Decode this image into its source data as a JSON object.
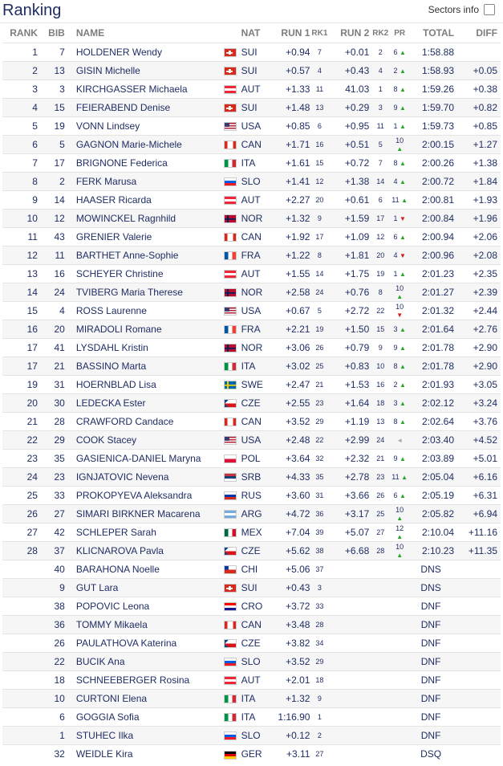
{
  "page": {
    "title": "Ranking",
    "sectors_label": "Sectors info"
  },
  "columns": {
    "rank": "RANK",
    "bib": "BIB",
    "name": "NAME",
    "nat": "NAT",
    "run1": "RUN 1",
    "rk1": "RK1",
    "run2": "RUN 2",
    "rk2": "RK2",
    "pr": "PR",
    "total": "TOTAL",
    "diff": "DIFF"
  },
  "rows": [
    {
      "rank": "1",
      "bib": "7",
      "name": "HOLDENER Wendy",
      "nat": "SUI",
      "run1": "+0.94",
      "rk1": "7",
      "run2": "+0.01",
      "rk2": "2",
      "pr": "6",
      "dir": "up",
      "total": "1:58.88",
      "diff": ""
    },
    {
      "rank": "2",
      "bib": "13",
      "name": "GISIN Michelle",
      "nat": "SUI",
      "run1": "+0.57",
      "rk1": "4",
      "run2": "+0.43",
      "rk2": "4",
      "pr": "2",
      "dir": "up",
      "total": "1:58.93",
      "diff": "+0.05"
    },
    {
      "rank": "3",
      "bib": "3",
      "name": "KIRCHGASSER Michaela",
      "nat": "AUT",
      "run1": "+1.33",
      "rk1": "11",
      "run2": "41.03",
      "rk2": "1",
      "pr": "8",
      "dir": "up",
      "total": "1:59.26",
      "diff": "+0.38"
    },
    {
      "rank": "4",
      "bib": "15",
      "name": "FEIERABEND Denise",
      "nat": "SUI",
      "run1": "+1.48",
      "rk1": "13",
      "run2": "+0.29",
      "rk2": "3",
      "pr": "9",
      "dir": "up",
      "total": "1:59.70",
      "diff": "+0.82"
    },
    {
      "rank": "5",
      "bib": "19",
      "name": "VONN Lindsey",
      "nat": "USA",
      "run1": "+0.85",
      "rk1": "6",
      "run2": "+0.95",
      "rk2": "11",
      "pr": "1",
      "dir": "up",
      "total": "1:59.73",
      "diff": "+0.85"
    },
    {
      "rank": "6",
      "bib": "5",
      "name": "GAGNON Marie-Michele",
      "nat": "CAN",
      "run1": "+1.71",
      "rk1": "16",
      "run2": "+0.51",
      "rk2": "5",
      "pr": "10",
      "dir": "up",
      "total": "2:00.15",
      "diff": "+1.27"
    },
    {
      "rank": "7",
      "bib": "17",
      "name": "BRIGNONE Federica",
      "nat": "ITA",
      "run1": "+1.61",
      "rk1": "15",
      "run2": "+0.72",
      "rk2": "7",
      "pr": "8",
      "dir": "up",
      "total": "2:00.26",
      "diff": "+1.38"
    },
    {
      "rank": "8",
      "bib": "2",
      "name": "FERK Marusa",
      "nat": "SLO",
      "run1": "+1.41",
      "rk1": "12",
      "run2": "+1.38",
      "rk2": "14",
      "pr": "4",
      "dir": "up",
      "total": "2:00.72",
      "diff": "+1.84"
    },
    {
      "rank": "9",
      "bib": "14",
      "name": "HAASER Ricarda",
      "nat": "AUT",
      "run1": "+2.27",
      "rk1": "20",
      "run2": "+0.61",
      "rk2": "6",
      "pr": "11",
      "dir": "up",
      "total": "2:00.81",
      "diff": "+1.93"
    },
    {
      "rank": "10",
      "bib": "12",
      "name": "MOWINCKEL Ragnhild",
      "nat": "NOR",
      "run1": "+1.32",
      "rk1": "9",
      "run2": "+1.59",
      "rk2": "17",
      "pr": "1",
      "dir": "down",
      "total": "2:00.84",
      "diff": "+1.96"
    },
    {
      "rank": "11",
      "bib": "43",
      "name": "GRENIER Valerie",
      "nat": "CAN",
      "run1": "+1.92",
      "rk1": "17",
      "run2": "+1.09",
      "rk2": "12",
      "pr": "6",
      "dir": "up",
      "total": "2:00.94",
      "diff": "+2.06"
    },
    {
      "rank": "12",
      "bib": "11",
      "name": "BARTHET Anne-Sophie",
      "nat": "FRA",
      "run1": "+1.22",
      "rk1": "8",
      "run2": "+1.81",
      "rk2": "20",
      "pr": "4",
      "dir": "down",
      "total": "2:00.96",
      "diff": "+2.08"
    },
    {
      "rank": "13",
      "bib": "16",
      "name": "SCHEYER Christine",
      "nat": "AUT",
      "run1": "+1.55",
      "rk1": "14",
      "run2": "+1.75",
      "rk2": "19",
      "pr": "1",
      "dir": "up",
      "total": "2:01.23",
      "diff": "+2.35"
    },
    {
      "rank": "14",
      "bib": "24",
      "name": "TVIBERG Maria Therese",
      "nat": "NOR",
      "run1": "+2.58",
      "rk1": "24",
      "run2": "+0.76",
      "rk2": "8",
      "pr": "10",
      "dir": "up",
      "total": "2:01.27",
      "diff": "+2.39"
    },
    {
      "rank": "15",
      "bib": "4",
      "name": "ROSS Laurenne",
      "nat": "USA",
      "run1": "+0.67",
      "rk1": "5",
      "run2": "+2.72",
      "rk2": "22",
      "pr": "10",
      "dir": "down",
      "total": "2:01.32",
      "diff": "+2.44"
    },
    {
      "rank": "16",
      "bib": "20",
      "name": "MIRADOLI Romane",
      "nat": "FRA",
      "run1": "+2.21",
      "rk1": "19",
      "run2": "+1.50",
      "rk2": "15",
      "pr": "3",
      "dir": "up",
      "total": "2:01.64",
      "diff": "+2.76"
    },
    {
      "rank": "17",
      "bib": "41",
      "name": "LYSDAHL Kristin",
      "nat": "NOR",
      "run1": "+3.06",
      "rk1": "26",
      "run2": "+0.79",
      "rk2": "9",
      "pr": "9",
      "dir": "up",
      "total": "2:01.78",
      "diff": "+2.90"
    },
    {
      "rank": "17",
      "bib": "21",
      "name": "BASSINO Marta",
      "nat": "ITA",
      "run1": "+3.02",
      "rk1": "25",
      "run2": "+0.83",
      "rk2": "10",
      "pr": "8",
      "dir": "up",
      "total": "2:01.78",
      "diff": "+2.90"
    },
    {
      "rank": "19",
      "bib": "31",
      "name": "HOERNBLAD Lisa",
      "nat": "SWE",
      "run1": "+2.47",
      "rk1": "21",
      "run2": "+1.53",
      "rk2": "16",
      "pr": "2",
      "dir": "up",
      "total": "2:01.93",
      "diff": "+3.05"
    },
    {
      "rank": "20",
      "bib": "30",
      "name": "LEDECKA Ester",
      "nat": "CZE",
      "run1": "+2.55",
      "rk1": "23",
      "run2": "+1.64",
      "rk2": "18",
      "pr": "3",
      "dir": "up",
      "total": "2:02.12",
      "diff": "+3.24"
    },
    {
      "rank": "21",
      "bib": "28",
      "name": "CRAWFORD Candace",
      "nat": "CAN",
      "run1": "+3.52",
      "rk1": "29",
      "run2": "+1.19",
      "rk2": "13",
      "pr": "8",
      "dir": "up",
      "total": "2:02.64",
      "diff": "+3.76"
    },
    {
      "rank": "22",
      "bib": "29",
      "name": "COOK Stacey",
      "nat": "USA",
      "run1": "+2.48",
      "rk1": "22",
      "run2": "+2.99",
      "rk2": "24",
      "pr": "",
      "dir": "eq",
      "total": "2:03.40",
      "diff": "+4.52"
    },
    {
      "rank": "23",
      "bib": "35",
      "name": "GASIENICA-DANIEL Maryna",
      "nat": "POL",
      "run1": "+3.64",
      "rk1": "32",
      "run2": "+2.32",
      "rk2": "21",
      "pr": "9",
      "dir": "up",
      "total": "2:03.89",
      "diff": "+5.01"
    },
    {
      "rank": "24",
      "bib": "23",
      "name": "IGNJATOVIC Nevena",
      "nat": "SRB",
      "run1": "+4.33",
      "rk1": "35",
      "run2": "+2.78",
      "rk2": "23",
      "pr": "11",
      "dir": "up",
      "total": "2:05.04",
      "diff": "+6.16"
    },
    {
      "rank": "25",
      "bib": "33",
      "name": "PROKOPYEVA Aleksandra",
      "nat": "RUS",
      "run1": "+3.60",
      "rk1": "31",
      "run2": "+3.66",
      "rk2": "26",
      "pr": "6",
      "dir": "up",
      "total": "2:05.19",
      "diff": "+6.31"
    },
    {
      "rank": "26",
      "bib": "27",
      "name": "SIMARI BIRKNER Macarena",
      "nat": "ARG",
      "run1": "+4.72",
      "rk1": "36",
      "run2": "+3.17",
      "rk2": "25",
      "pr": "10",
      "dir": "up",
      "total": "2:05.82",
      "diff": "+6.94"
    },
    {
      "rank": "27",
      "bib": "42",
      "name": "SCHLEPER Sarah",
      "nat": "MEX",
      "run1": "+7.04",
      "rk1": "39",
      "run2": "+5.07",
      "rk2": "27",
      "pr": "12",
      "dir": "up",
      "total": "2:10.04",
      "diff": "+11.16"
    },
    {
      "rank": "28",
      "bib": "37",
      "name": "KLICNAROVA Pavla",
      "nat": "CZE",
      "run1": "+5.62",
      "rk1": "38",
      "run2": "+6.68",
      "rk2": "28",
      "pr": "10",
      "dir": "up",
      "total": "2:10.23",
      "diff": "+11.35"
    },
    {
      "rank": "",
      "bib": "40",
      "name": "BARAHONA Noelle",
      "nat": "CHI",
      "run1": "+5.06",
      "rk1": "37",
      "run2": "",
      "rk2": "",
      "pr": "",
      "dir": "",
      "total": "DNS",
      "diff": ""
    },
    {
      "rank": "",
      "bib": "9",
      "name": "GUT Lara",
      "nat": "SUI",
      "run1": "+0.43",
      "rk1": "3",
      "run2": "",
      "rk2": "",
      "pr": "",
      "dir": "",
      "total": "DNS",
      "diff": ""
    },
    {
      "rank": "",
      "bib": "38",
      "name": "POPOVIC Leona",
      "nat": "CRO",
      "run1": "+3.72",
      "rk1": "33",
      "run2": "",
      "rk2": "",
      "pr": "",
      "dir": "",
      "total": "DNF",
      "diff": ""
    },
    {
      "rank": "",
      "bib": "36",
      "name": "TOMMY Mikaela",
      "nat": "CAN",
      "run1": "+3.48",
      "rk1": "28",
      "run2": "",
      "rk2": "",
      "pr": "",
      "dir": "",
      "total": "DNF",
      "diff": ""
    },
    {
      "rank": "",
      "bib": "26",
      "name": "PAULATHOVA Katerina",
      "nat": "CZE",
      "run1": "+3.82",
      "rk1": "34",
      "run2": "",
      "rk2": "",
      "pr": "",
      "dir": "",
      "total": "DNF",
      "diff": ""
    },
    {
      "rank": "",
      "bib": "22",
      "name": "BUCIK Ana",
      "nat": "SLO",
      "run1": "+3.52",
      "rk1": "29",
      "run2": "",
      "rk2": "",
      "pr": "",
      "dir": "",
      "total": "DNF",
      "diff": ""
    },
    {
      "rank": "",
      "bib": "18",
      "name": "SCHNEEBERGER Rosina",
      "nat": "AUT",
      "run1": "+2.01",
      "rk1": "18",
      "run2": "",
      "rk2": "",
      "pr": "",
      "dir": "",
      "total": "DNF",
      "diff": ""
    },
    {
      "rank": "",
      "bib": "10",
      "name": "CURTONI Elena",
      "nat": "ITA",
      "run1": "+1.32",
      "rk1": "9",
      "run2": "",
      "rk2": "",
      "pr": "",
      "dir": "",
      "total": "DNF",
      "diff": ""
    },
    {
      "rank": "",
      "bib": "6",
      "name": "GOGGIA Sofia",
      "nat": "ITA",
      "run1": "1:16.90",
      "rk1": "1",
      "run2": "",
      "rk2": "",
      "pr": "",
      "dir": "",
      "total": "DNF",
      "diff": ""
    },
    {
      "rank": "",
      "bib": "1",
      "name": "STUHEC Ilka",
      "nat": "SLO",
      "run1": "+0.12",
      "rk1": "2",
      "run2": "",
      "rk2": "",
      "pr": "",
      "dir": "",
      "total": "DNF",
      "diff": ""
    },
    {
      "rank": "",
      "bib": "32",
      "name": "WEIDLE Kira",
      "nat": "GER",
      "run1": "+3.11",
      "rk1": "27",
      "run2": "",
      "rk2": "",
      "pr": "",
      "dir": "",
      "total": "DSQ",
      "diff": ""
    }
  ],
  "arrows": {
    "up": "▲",
    "down": "▼",
    "eq": "◄"
  },
  "flags": {
    "SUI": {
      "bg": "#d52b1e",
      "mark": "cross"
    },
    "AUT": {
      "bg": "#ed2939",
      "band": "#ffffff",
      "orient": "h3"
    },
    "USA": {
      "bg": "#b22234",
      "canton": "#3c3b6e"
    },
    "CAN": {
      "bg": "#ffffff",
      "side": "#d52b1e"
    },
    "ITA": {
      "stripes": [
        "#009246",
        "#ffffff",
        "#ce2b37"
      ],
      "orient": "v"
    },
    "SLO": {
      "stripes": [
        "#ffffff",
        "#005ce6",
        "#ed1c24"
      ],
      "orient": "h"
    },
    "NOR": {
      "bg": "#ba0c2f",
      "mark": "nordic",
      "cross": "#00205b"
    },
    "FRA": {
      "stripes": [
        "#0055a4",
        "#ffffff",
        "#ef4135"
      ],
      "orient": "v"
    },
    "SWE": {
      "bg": "#006aa7",
      "mark": "nordic",
      "cross": "#fecc00"
    },
    "CZE": {
      "stripes": [
        "#ffffff",
        "#d7141a"
      ],
      "orient": "h",
      "tri": "#11457e"
    },
    "POL": {
      "stripes": [
        "#ffffff",
        "#dc143c"
      ],
      "orient": "h"
    },
    "SRB": {
      "stripes": [
        "#c6363c",
        "#0c4076",
        "#ffffff"
      ],
      "orient": "h"
    },
    "RUS": {
      "stripes": [
        "#ffffff",
        "#0039a6",
        "#d52b1e"
      ],
      "orient": "h"
    },
    "ARG": {
      "stripes": [
        "#74acdf",
        "#ffffff",
        "#74acdf"
      ],
      "orient": "h"
    },
    "MEX": {
      "stripes": [
        "#006847",
        "#ffffff",
        "#ce1126"
      ],
      "orient": "v"
    },
    "CHI": {
      "stripes": [
        "#ffffff",
        "#d52b1e"
      ],
      "orient": "h",
      "canton": "#0039a6"
    },
    "CRO": {
      "stripes": [
        "#ff0000",
        "#ffffff",
        "#171796"
      ],
      "orient": "h"
    },
    "GER": {
      "stripes": [
        "#000000",
        "#dd0000",
        "#ffce00"
      ],
      "orient": "h"
    }
  }
}
